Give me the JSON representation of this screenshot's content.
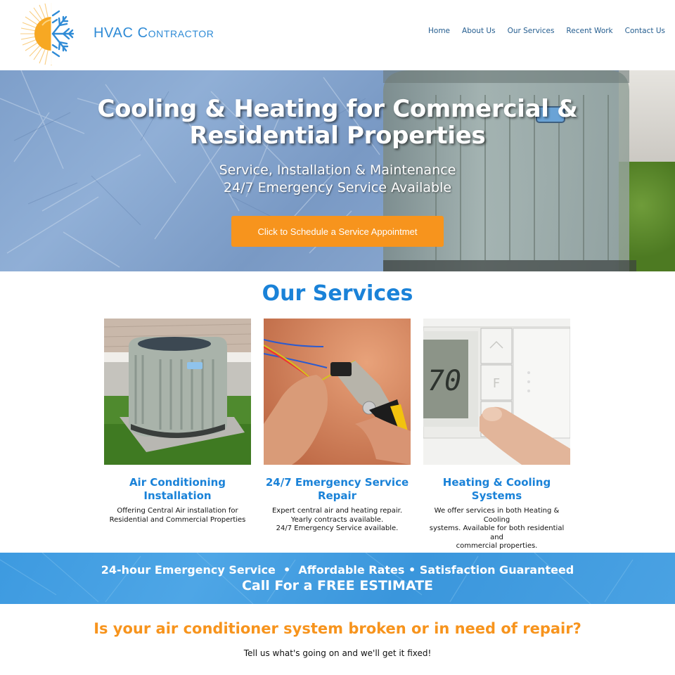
{
  "header": {
    "brand": "HVAC Contractor",
    "logo_icon": "sun-snowflake-logo",
    "nav": [
      {
        "label": "Home"
      },
      {
        "label": "About Us"
      },
      {
        "label": "Our Services"
      },
      {
        "label": "Recent Work"
      },
      {
        "label": "Contact Us"
      }
    ]
  },
  "hero": {
    "title_line1": "Cooling & Heating for Commercial &",
    "title_line2": "Residential Properties",
    "subtitle_line1": "Service, Installation & Maintenance",
    "subtitle_line2": "24/7 Emergency Service Available",
    "cta_label": "Click to Schedule a Service Appointmet"
  },
  "services": {
    "title": "Our Services",
    "items": [
      {
        "image": "outdoor-ac-unit-photo",
        "title_line1": "Air Conditioning",
        "title_line2": "Installation",
        "desc_lines": [
          "Offering Central Air installation for",
          "Residential and Commercial Properties"
        ]
      },
      {
        "image": "wire-stripper-hands-photo",
        "title_line1": "24/7 Emergency Service",
        "title_line2": "Repair",
        "desc_lines": [
          "Expert central air and heating repair.",
          "Yearly contracts available.",
          "24/7 Emergency Service available."
        ]
      },
      {
        "image": "thermostat-photo",
        "thermostat_reading": "70",
        "thermostat_unit": "F",
        "title_line1": "Heating & Cooling",
        "title_line2": "Systems",
        "desc_lines": [
          "We offer services in both Heating & Cooling",
          "systems. Available for both residential and",
          "commercial properties."
        ]
      }
    ]
  },
  "banner": {
    "line1": "24-hour Emergency Service  •  Affordable Rates • Satisfaction Guaranteed",
    "line2": "Call For a FREE ESTIMATE"
  },
  "repair": {
    "title": "Is your air conditioner system broken or in need of repair?",
    "subtitle": "Tell us what's going on and we'll get it fixed!"
  },
  "colors": {
    "brand_blue": "#1a82d8",
    "nav_blue": "#245d8f",
    "accent_orange": "#f7941d",
    "banner_blue": "#3d9ae0"
  }
}
